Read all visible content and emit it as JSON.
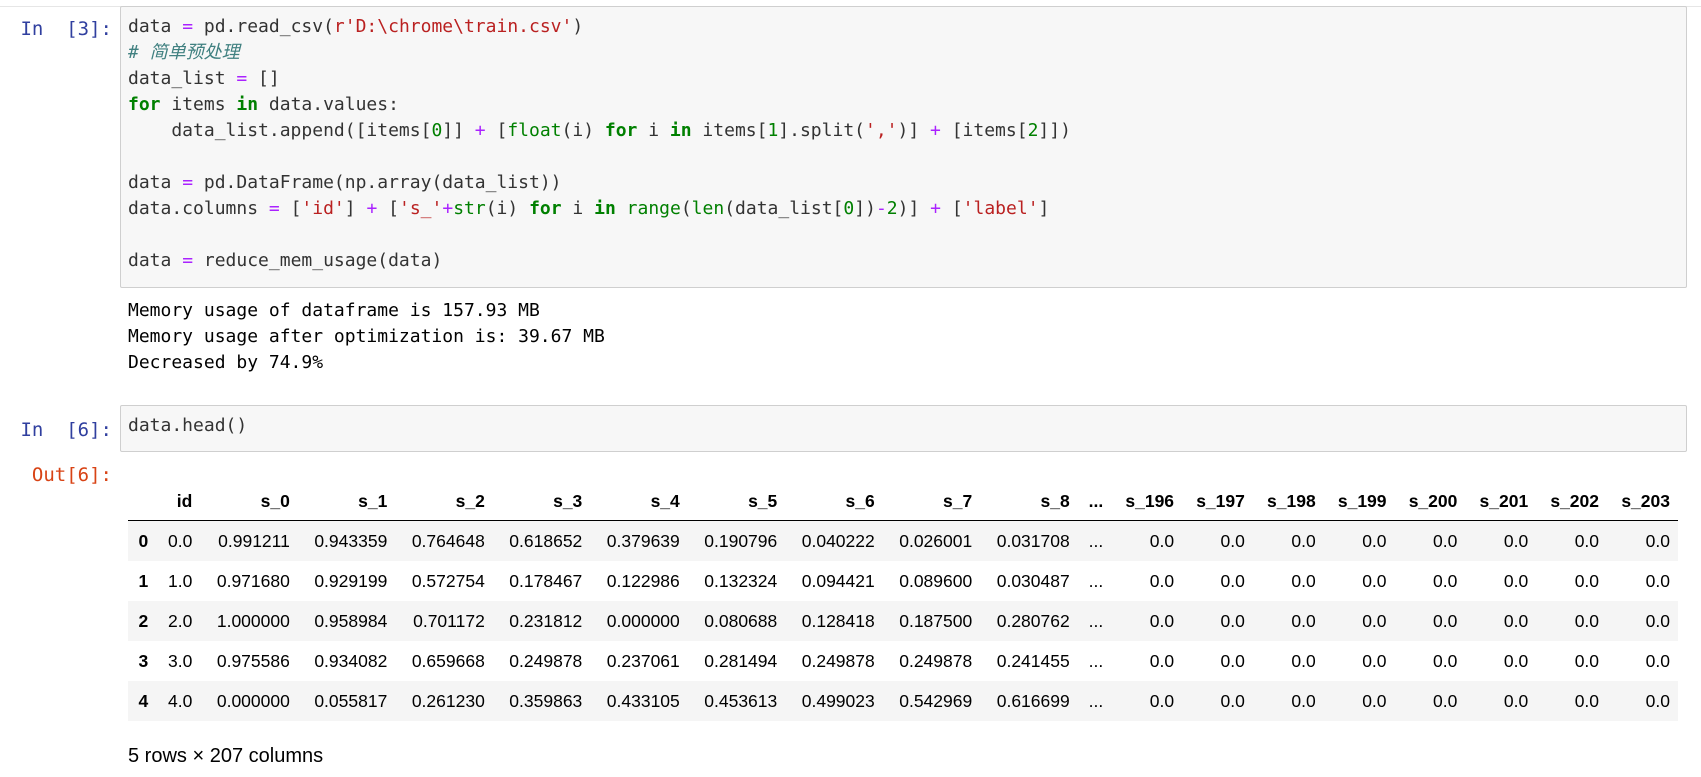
{
  "cells": [
    {
      "prompt": "In  [3]:",
      "code_lines": [
        [
          [
            "n_",
            "data "
          ],
          [
            "o",
            "="
          ],
          [
            "n_",
            " pd.read_csv("
          ],
          [
            "s",
            "r'D:\\chrome\\train.csv'"
          ],
          [
            "n_",
            ")"
          ]
        ],
        [
          [
            "c",
            "# 简单预处理"
          ]
        ],
        [
          [
            "n_",
            "data_list "
          ],
          [
            "o",
            "="
          ],
          [
            "n_",
            " []"
          ]
        ],
        [
          [
            "k",
            "for"
          ],
          [
            "n_",
            " items "
          ],
          [
            "k",
            "in"
          ],
          [
            "n_",
            " data.values:"
          ]
        ],
        [
          [
            "n_",
            "    data_list.append([items["
          ],
          [
            "n",
            "0"
          ],
          [
            "n_",
            "]] "
          ],
          [
            "o",
            "+"
          ],
          [
            "n_",
            " ["
          ],
          [
            "b",
            "float"
          ],
          [
            "n_",
            "(i) "
          ],
          [
            "k",
            "for"
          ],
          [
            "n_",
            " i "
          ],
          [
            "k",
            "in"
          ],
          [
            "n_",
            " items["
          ],
          [
            "n",
            "1"
          ],
          [
            "n_",
            "].split("
          ],
          [
            "s",
            "','"
          ],
          [
            "n_",
            ")] "
          ],
          [
            "o",
            "+"
          ],
          [
            "n_",
            " [items["
          ],
          [
            "n",
            "2"
          ],
          [
            "n_",
            "]])"
          ]
        ],
        [
          [
            "n_",
            ""
          ]
        ],
        [
          [
            "n_",
            "data "
          ],
          [
            "o",
            "="
          ],
          [
            "n_",
            " pd.DataFrame(np.array(data_list))"
          ]
        ],
        [
          [
            "n_",
            "data.columns "
          ],
          [
            "o",
            "="
          ],
          [
            "n_",
            " ["
          ],
          [
            "s",
            "'id'"
          ],
          [
            "n_",
            "] "
          ],
          [
            "o",
            "+"
          ],
          [
            "n_",
            " ["
          ],
          [
            "s",
            "'s_'"
          ],
          [
            "o",
            "+"
          ],
          [
            "b",
            "str"
          ],
          [
            "n_",
            "(i) "
          ],
          [
            "k",
            "for"
          ],
          [
            "n_",
            " i "
          ],
          [
            "k",
            "in"
          ],
          [
            "n_",
            " "
          ],
          [
            "b",
            "range"
          ],
          [
            "n_",
            "("
          ],
          [
            "b",
            "len"
          ],
          [
            "n_",
            "(data_list["
          ],
          [
            "n",
            "0"
          ],
          [
            "n_",
            "])"
          ],
          [
            "o",
            "-"
          ],
          [
            "n",
            "2"
          ],
          [
            "n_",
            ")] "
          ],
          [
            "o",
            "+"
          ],
          [
            "n_",
            " ["
          ],
          [
            "s",
            "'label'"
          ],
          [
            "n_",
            "]"
          ]
        ],
        [
          [
            "n_",
            ""
          ]
        ],
        [
          [
            "n_",
            "data "
          ],
          [
            "o",
            "="
          ],
          [
            "n_",
            " reduce_mem_usage(data)"
          ]
        ]
      ],
      "output": [
        "Memory usage of dataframe is 157.93 MB",
        "Memory usage after optimization is: 39.67 MB",
        "Decreased by 74.9%"
      ]
    },
    {
      "prompt": "In  [6]:",
      "code_lines": [
        [
          [
            "n_",
            "data.head()"
          ]
        ]
      ],
      "out_prompt": "Out[6]:"
    }
  ],
  "dataframe": {
    "columns": [
      "",
      "id",
      "s_0",
      "s_1",
      "s_2",
      "s_3",
      "s_4",
      "s_5",
      "s_6",
      "s_7",
      "s_8",
      "...",
      "s_196",
      "s_197",
      "s_198",
      "s_199",
      "s_200",
      "s_201",
      "s_202",
      "s_203"
    ],
    "rows": [
      [
        "0",
        "0.0",
        "0.991211",
        "0.943359",
        "0.764648",
        "0.618652",
        "0.379639",
        "0.190796",
        "0.040222",
        "0.026001",
        "0.031708",
        "...",
        "0.0",
        "0.0",
        "0.0",
        "0.0",
        "0.0",
        "0.0",
        "0.0",
        "0.0"
      ],
      [
        "1",
        "1.0",
        "0.971680",
        "0.929199",
        "0.572754",
        "0.178467",
        "0.122986",
        "0.132324",
        "0.094421",
        "0.089600",
        "0.030487",
        "...",
        "0.0",
        "0.0",
        "0.0",
        "0.0",
        "0.0",
        "0.0",
        "0.0",
        "0.0"
      ],
      [
        "2",
        "2.0",
        "1.000000",
        "0.958984",
        "0.701172",
        "0.231812",
        "0.000000",
        "0.080688",
        "0.128418",
        "0.187500",
        "0.280762",
        "...",
        "0.0",
        "0.0",
        "0.0",
        "0.0",
        "0.0",
        "0.0",
        "0.0",
        "0.0"
      ],
      [
        "3",
        "3.0",
        "0.975586",
        "0.934082",
        "0.659668",
        "0.249878",
        "0.237061",
        "0.281494",
        "0.249878",
        "0.249878",
        "0.241455",
        "...",
        "0.0",
        "0.0",
        "0.0",
        "0.0",
        "0.0",
        "0.0",
        "0.0",
        "0.0"
      ],
      [
        "4",
        "4.0",
        "0.000000",
        "0.055817",
        "0.261230",
        "0.359863",
        "0.433105",
        "0.453613",
        "0.499023",
        "0.542969",
        "0.616699",
        "...",
        "0.0",
        "0.0",
        "0.0",
        "0.0",
        "0.0",
        "0.0",
        "0.0",
        "0.0"
      ]
    ],
    "shape_text": "5 rows × 207 columns"
  }
}
